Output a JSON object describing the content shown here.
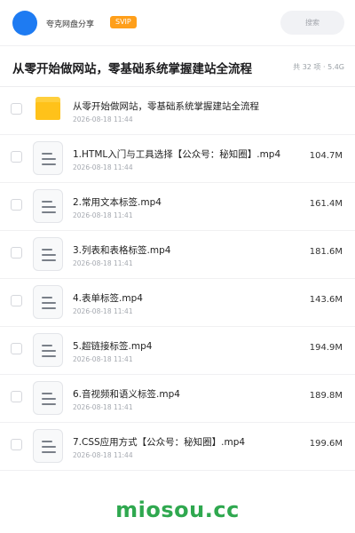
{
  "header": {
    "sharer_name": "夸克网盘分享",
    "badge": "SVIP",
    "search_placeholder": "搜索"
  },
  "share": {
    "title": "从零开始做网站，零基础系统掌握建站全流程",
    "meta": "共 32 项 · 5.4G"
  },
  "items": [
    {
      "type": "folder",
      "name": "从零开始做网站，零基础系统掌握建站全流程",
      "date": "2026-08-18 11:44",
      "size": ""
    },
    {
      "type": "file",
      "name": "1.HTML入门与工具选择【公众号：秘知圈】.mp4",
      "date": "2026-08-18 11:44",
      "size": "104.7M"
    },
    {
      "type": "file",
      "name": "2.常用文本标签.mp4",
      "date": "2026-08-18 11:41",
      "size": "161.4M"
    },
    {
      "type": "file",
      "name": "3.列表和表格标签.mp4",
      "date": "2026-08-18 11:41",
      "size": "181.6M"
    },
    {
      "type": "file",
      "name": "4.表单标签.mp4",
      "date": "2026-08-18 11:41",
      "size": "143.6M"
    },
    {
      "type": "file",
      "name": "5.超链接标签.mp4",
      "date": "2026-08-18 11:41",
      "size": "194.9M"
    },
    {
      "type": "file",
      "name": "6.音视频和语义标签.mp4",
      "date": "2026-08-18 11:41",
      "size": "189.8M"
    },
    {
      "type": "file",
      "name": "7.CSS应用方式【公众号：秘知圈】.mp4",
      "date": "2026-08-18 11:44",
      "size": "199.6M"
    }
  ],
  "watermark": "miosou.cc",
  "colors": {
    "accent_blue": "#1e7bf2",
    "svip_orange": "#ff9f1a",
    "folder_yellow": "#ffc21a",
    "watermark_green": "#2fa84f"
  }
}
